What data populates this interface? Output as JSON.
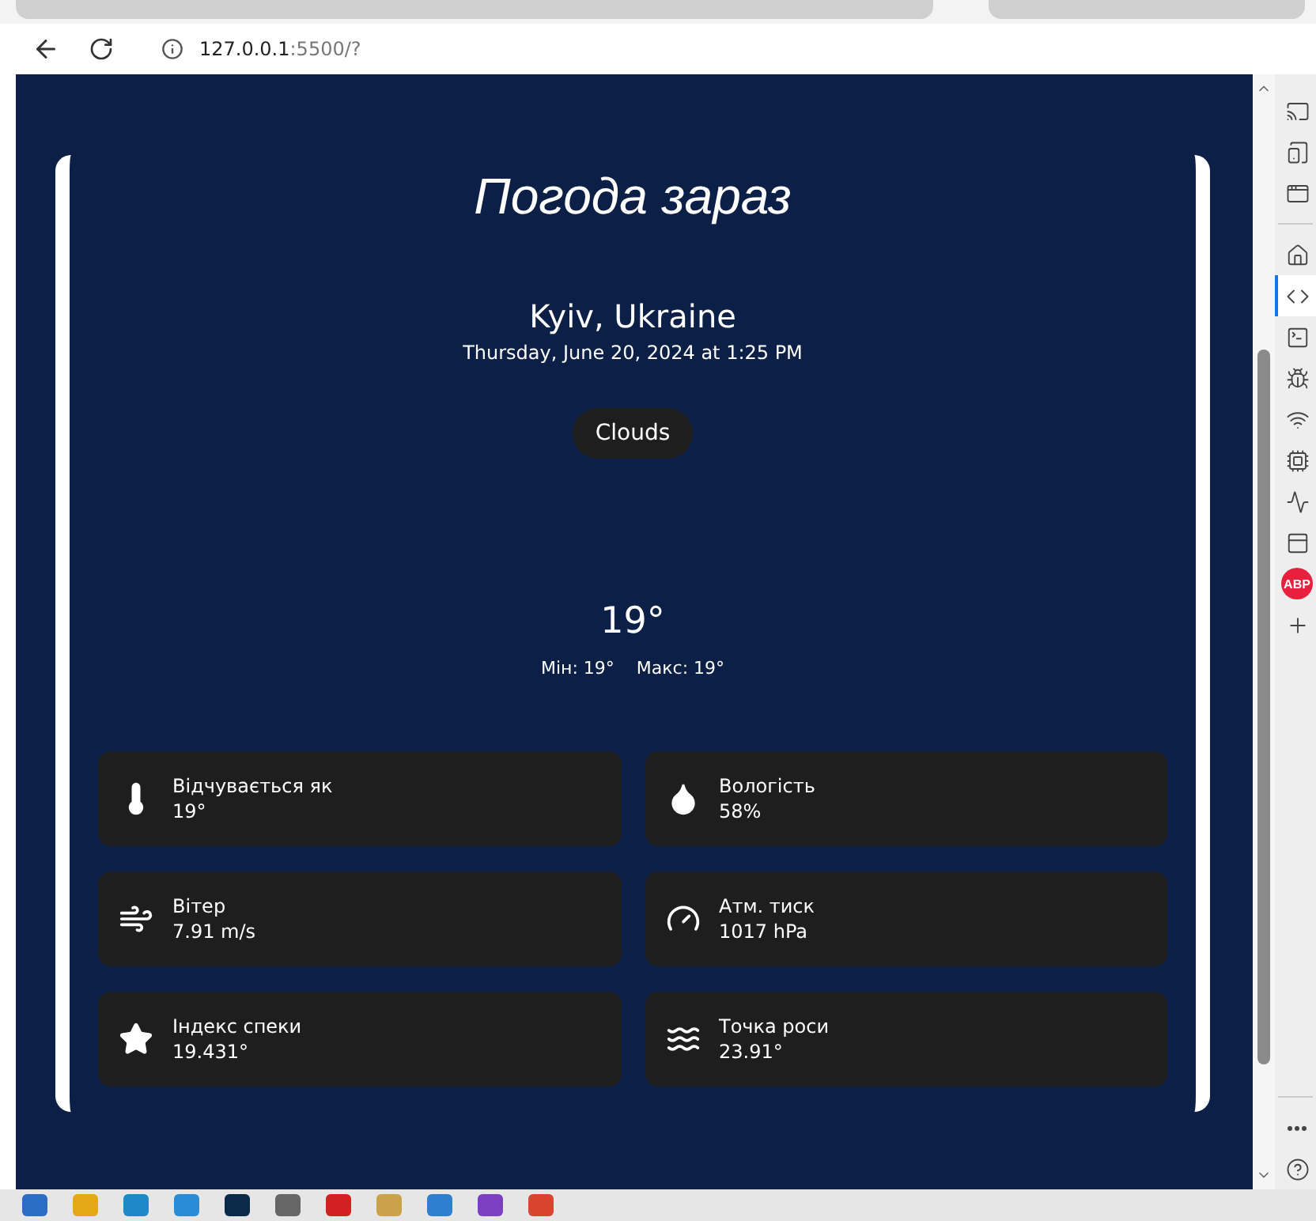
{
  "browser": {
    "url_host": "127.0.0.1",
    "url_path": ":5500/?"
  },
  "page": {
    "title": "Погода зараз",
    "location": "Kyiv, Ukraine",
    "datetime": "Thursday, June 20, 2024 at 1:25 PM",
    "condition": "Clouds",
    "temperature": "19°",
    "min": "Мін: 19°",
    "max": "Макс: 19°",
    "details": [
      {
        "kind": "thermometer",
        "label": "Відчувається як",
        "value": "19°"
      },
      {
        "kind": "drop",
        "label": "Вологість",
        "value": "58%"
      },
      {
        "kind": "wind",
        "label": "Вітер",
        "value": "7.91 m/s"
      },
      {
        "kind": "gauge",
        "label": "Атм. тиск",
        "value": "1017 hPa"
      },
      {
        "kind": "star",
        "label": "Індекс спеки",
        "value": "19.431°"
      },
      {
        "kind": "waves",
        "label": "Точка роси",
        "value": "23.91°"
      }
    ]
  },
  "devtools": {
    "items": [
      {
        "kind": "cast",
        "selected": false
      },
      {
        "kind": "device",
        "selected": false
      },
      {
        "kind": "window",
        "selected": false
      },
      {
        "kind": "home",
        "selected": false
      },
      {
        "kind": "code",
        "selected": true
      },
      {
        "kind": "console",
        "selected": false
      },
      {
        "kind": "bug",
        "selected": false
      },
      {
        "kind": "wifi",
        "selected": false
      },
      {
        "kind": "cpu",
        "selected": false
      },
      {
        "kind": "performance",
        "selected": false
      },
      {
        "kind": "panel",
        "selected": false
      },
      {
        "kind": "abp",
        "label": "ABP",
        "selected": false
      },
      {
        "kind": "add",
        "selected": false
      }
    ]
  }
}
